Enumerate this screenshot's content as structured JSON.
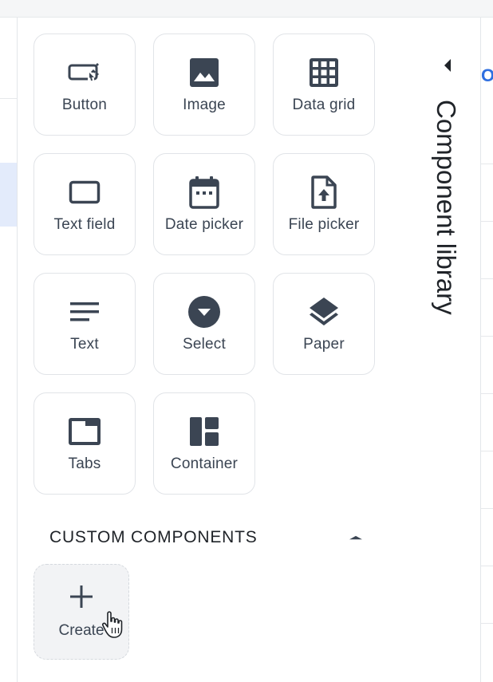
{
  "components": {
    "button": {
      "label": "Button",
      "icon": "button-icon"
    },
    "image": {
      "label": "Image",
      "icon": "image-icon"
    },
    "data_grid": {
      "label": "Data grid",
      "icon": "grid-icon"
    },
    "text_field": {
      "label": "Text field",
      "icon": "text-field-icon"
    },
    "date_picker": {
      "label": "Date picker",
      "icon": "calendar-icon"
    },
    "file_picker": {
      "label": "File picker",
      "icon": "file-upload-icon"
    },
    "text": {
      "label": "Text",
      "icon": "text-lines-icon"
    },
    "select": {
      "label": "Select",
      "icon": "dropdown-circle-icon"
    },
    "paper": {
      "label": "Paper",
      "icon": "layers-icon"
    },
    "tabs": {
      "label": "Tabs",
      "icon": "tabs-icon"
    },
    "container": {
      "label": "Container",
      "icon": "dashboard-layout-icon"
    }
  },
  "custom": {
    "title": "CUSTOM COMPONENTS",
    "create_label": "Create",
    "toggle_icon": "caret-up-icon"
  },
  "library": {
    "title": "Component library",
    "collapse_icon": "caret-left-icon"
  },
  "right_peek_text": "O",
  "colors": {
    "icon": "#3b4553",
    "tile_border": "#e1e4e8",
    "selected_row": "#e3ebfb",
    "link_blue": "#2f6fe0"
  }
}
